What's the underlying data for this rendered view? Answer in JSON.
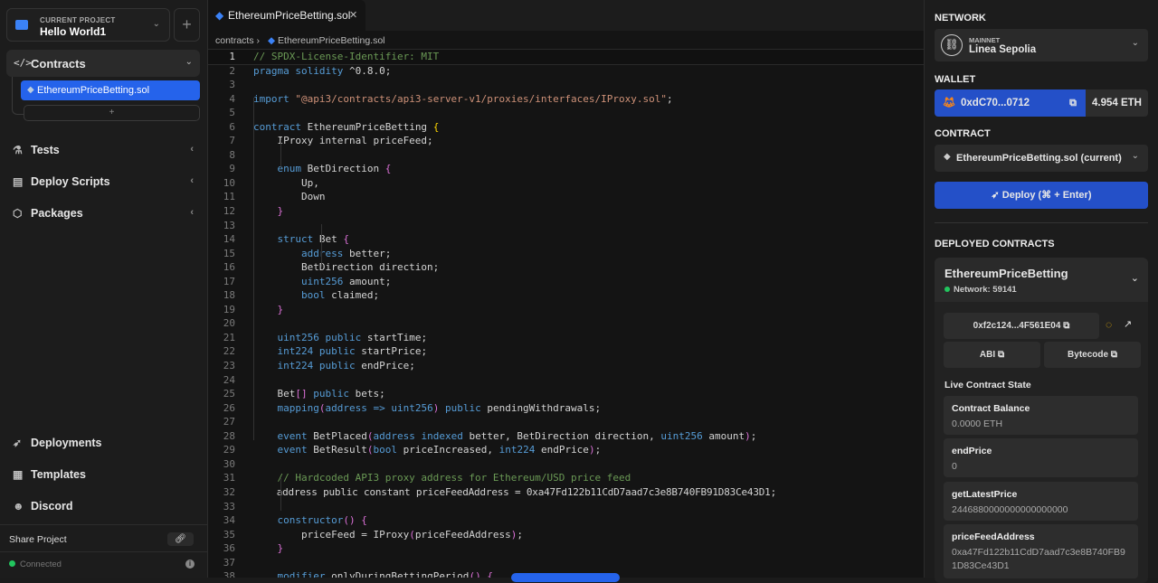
{
  "sidebar": {
    "project_label": "CURRENT PROJECT",
    "project_name": "Hello World1",
    "add_label": "+",
    "contracts_label": "Contracts",
    "file": "EthereumPriceBetting.sol",
    "add_file": "+",
    "nav": [
      {
        "label": "Tests",
        "icon": "flask-icon"
      },
      {
        "label": "Deploy Scripts",
        "icon": "scroll-icon"
      },
      {
        "label": "Packages",
        "icon": "package-icon"
      }
    ],
    "bottom_nav": [
      {
        "label": "Deployments",
        "icon": "rocket-icon"
      },
      {
        "label": "Templates",
        "icon": "template-icon"
      },
      {
        "label": "Discord",
        "icon": "discord-icon"
      }
    ],
    "share_label": "Share Project",
    "status": "Connected"
  },
  "editor": {
    "tab": "EthereumPriceBetting.sol",
    "breadcrumb_root": "contracts",
    "breadcrumb_file": "EthereumPriceBetting.sol",
    "lines": [
      "// SPDX-License-Identifier: MIT",
      "pragma solidity ^0.8.0;",
      "",
      "import \"@api3/contracts/api3-server-v1/proxies/interfaces/IProxy.sol\";",
      "",
      "contract EthereumPriceBetting {",
      "    IProxy internal priceFeed;",
      "",
      "    enum BetDirection {",
      "        Up,",
      "        Down",
      "    }",
      "",
      "    struct Bet {",
      "        address better;",
      "        BetDirection direction;",
      "        uint256 amount;",
      "        bool claimed;",
      "    }",
      "",
      "    uint256 public startTime;",
      "    int224 public startPrice;",
      "    int224 public endPrice;",
      "",
      "    Bet[] public bets;",
      "    mapping(address => uint256) public pendingWithdrawals;",
      "",
      "    event BetPlaced(address indexed better, BetDirection direction, uint256 amount);",
      "    event BetResult(bool priceIncreased, int224 endPrice);",
      "",
      "    // Hardcoded API3 proxy address for Ethereum/USD price feed",
      "    address public constant priceFeedAddress = 0xa47Fd122b11CdD7aad7c3e8B740FB91D83Ce43D1;",
      "",
      "    constructor() {",
      "        priceFeed = IProxy(priceFeedAddress);",
      "    }",
      "",
      "    modifier onlyDuringBettingPeriod() {"
    ]
  },
  "right": {
    "network_title": "NETWORK",
    "network_kind": "MAINNET",
    "network_name": "Linea Sepolia",
    "wallet_title": "WALLET",
    "wallet_address": "0xdC70...0712",
    "wallet_balance": "4.954 ETH",
    "contract_title": "CONTRACT",
    "contract_selected": "EthereumPriceBetting.sol (current)",
    "deploy_label": "Deploy (⌘ + Enter)",
    "deployed_title": "DEPLOYED CONTRACTS",
    "deployed": {
      "name": "EthereumPriceBetting",
      "network": "Network: 59141",
      "address": "0xf2c124...4F561E04",
      "abi": "ABI",
      "bytecode": "Bytecode",
      "state_title": "Live Contract State",
      "state": [
        {
          "key": "Contract Balance",
          "value": "0.0000 ETH"
        },
        {
          "key": "endPrice",
          "value": "0"
        },
        {
          "key": "getLatestPrice",
          "value": "2446880000000000000000"
        },
        {
          "key": "priceFeedAddress",
          "value": "0xa47Fd122b11CdD7aad7c3e8B740FB91D83Ce43D1"
        }
      ]
    }
  }
}
